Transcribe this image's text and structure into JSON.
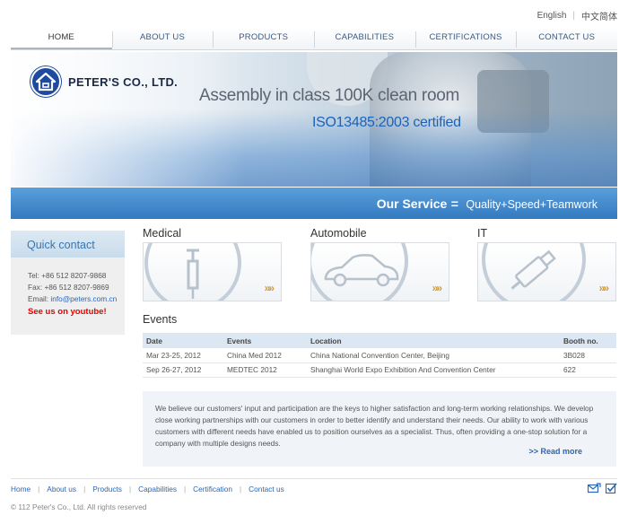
{
  "language": {
    "english": "English",
    "chinese": "中文简体"
  },
  "nav": [
    {
      "label": "HOME"
    },
    {
      "label": "ABOUT US"
    },
    {
      "label": "PRODUCTS"
    },
    {
      "label": "CAPABILITIES"
    },
    {
      "label": "CERTIFICATIONS"
    },
    {
      "label": "CONTACT US"
    }
  ],
  "banner": {
    "company": "PETER'S CO., LTD.",
    "headline": "Assembly in class 100K clean room",
    "subheadline": "ISO13485:2003 certified"
  },
  "service": {
    "label": "Our Service",
    "equals": "=",
    "value": "Quality+Speed+Teamwork"
  },
  "quick_contact": {
    "title": "Quick contact",
    "tel": "Tel: +86 512 8207-9868",
    "fax": "Fax: +86 512 8207-9869",
    "email_label": "Email: ",
    "email": "info@peters.com.cn",
    "youtube": "See us on youtube!"
  },
  "categories": [
    {
      "title": "Medical",
      "icon": "syringe-icon"
    },
    {
      "title": "Automobile",
      "icon": "car-icon"
    },
    {
      "title": "IT",
      "icon": "usb-drive-icon"
    }
  ],
  "category_arrow": "»»",
  "events": {
    "title": "Events",
    "headers": [
      "Date",
      "Events",
      "Location",
      "Booth no."
    ],
    "rows": [
      [
        "Mar 23-25, 2012",
        "China  Med  2012",
        "China National Convention Center, Beijing",
        "3B028"
      ],
      [
        "Sep 26-27, 2012",
        "MEDTEC 2012",
        "Shanghai World Expo Exhibition And Convention Center",
        "622"
      ]
    ]
  },
  "about": {
    "text": "We believe our customers' input and participation are the keys to higher satisfaction and long-term working relationships. We develop close working partnerships with our customers in order to better identify and understand their needs. Our ability to work with various customers with different needs have enabled us to position ourselves as a specialist. Thus, often providing a one-stop solution for a company with multiple designs needs.",
    "read_more": ">> Read more"
  },
  "footer": {
    "links": [
      "Home",
      "About us",
      "Products",
      "Capabilities",
      "Certification",
      "Contact us"
    ],
    "copyright": "© 112  Peter's Co., Ltd. All rights reserved"
  },
  "colors": {
    "brand_blue": "#1e4aa0",
    "service_band": "#3f86c9",
    "link": "#2a66b8",
    "youtube_red": "#e60000"
  }
}
